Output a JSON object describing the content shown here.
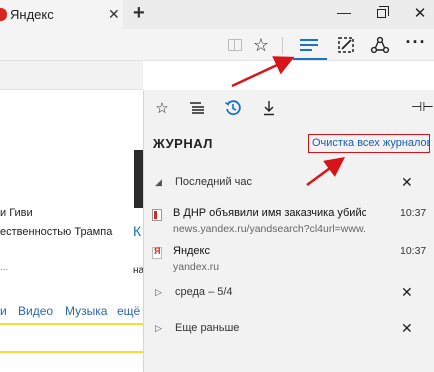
{
  "tab": {
    "title": "Яндекс",
    "close": "✕",
    "new_tab": "+"
  },
  "window": {
    "minimize": "—",
    "close": "✕"
  },
  "toolbar": {
    "star": "☆",
    "more": "···"
  },
  "page": {
    "news_1": "и Гиви",
    "news_2": "ественностью Трампа",
    "dots": "...",
    "link_k": "К",
    "na": "на",
    "nav_i": "и",
    "nav_video": "Видео",
    "nav_music": "Музыка",
    "nav_more": "ещё"
  },
  "hub": {
    "title": "ЖУРНАЛ",
    "clear_all": "Очистка всех журналов",
    "pin": "⊣⊢",
    "groups": [
      {
        "caret": "◢",
        "label": "Последний час",
        "close": "✕"
      },
      {
        "caret": "▷",
        "label": "среда – 5/4",
        "close": "✕"
      },
      {
        "caret": "▷",
        "label": "Еще раньше",
        "close": "✕"
      }
    ],
    "entries": [
      {
        "title": "В ДНР объявили имя заказчика убийства",
        "url": "news.yandex.ru/yandsearch?cl4url=www.k",
        "time": "10:37"
      },
      {
        "title": "Яндекс",
        "url": "yandex.ru",
        "time": "10:37"
      }
    ]
  },
  "colors": {
    "accent": "#1a73c8",
    "annotation_red": "#d8141b",
    "highlight_yellow": "#ffd83a"
  }
}
